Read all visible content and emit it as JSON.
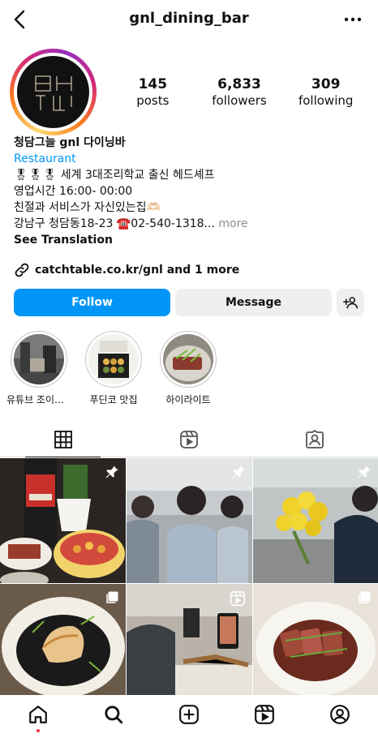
{
  "header": {
    "username": "gnl_dining_bar"
  },
  "profile": {
    "posts_count": "145",
    "posts_label": "posts",
    "followers_count": "6,833",
    "followers_label": "followers",
    "following_count": "309",
    "following_label": "following"
  },
  "bio": {
    "name": "청담그늘 gnl 다이닝바",
    "category": "Restaurant",
    "line1": "🎖🎖🎖 세계 3대조리학교 출신 헤드셰프",
    "line2": "영업시간 16:00- 00:00",
    "line3": "친절과 서비스가 자신있는집🫶🏻",
    "line4": "강남구 청담동18-23 ☎️02-540-1318...",
    "more": " more",
    "see_translation": "See Translation"
  },
  "link": {
    "text": "catchtable.co.kr/gnl and 1 more"
  },
  "actions": {
    "follow": "Follow",
    "message": "Message"
  },
  "highlights": [
    {
      "label": "유튜브 조이한…"
    },
    {
      "label": "푸딘코 맛집"
    },
    {
      "label": "하이라이트"
    }
  ],
  "colors": {
    "accent": "#0095f6",
    "button_gray": "#efefef",
    "notification": "#ff3040"
  },
  "icons": {
    "back": "chevron-left-icon",
    "more": "more-horizontal-icon",
    "link": "link-icon",
    "add_user": "add-user-icon",
    "tab_grid": "grid-icon",
    "tab_reels": "reels-icon",
    "tab_tagged": "tagged-icon",
    "nav": [
      "home-icon",
      "search-icon",
      "create-icon",
      "reels-icon",
      "profile-icon"
    ]
  }
}
